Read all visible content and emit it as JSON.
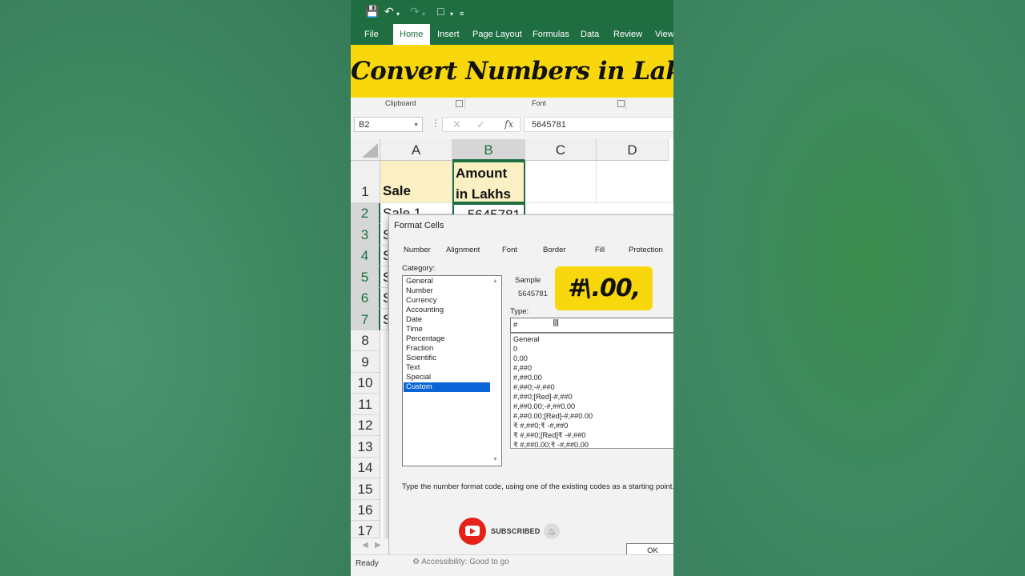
{
  "quick_access": {
    "save_icon": "save-icon",
    "undo_icon": "undo-icon",
    "redo_icon": "redo-icon",
    "present_icon": "present-icon",
    "customize_icon": "customize-icon"
  },
  "ribbon": {
    "tabs": [
      {
        "label": "File"
      },
      {
        "label": "Home"
      },
      {
        "label": "Insert"
      },
      {
        "label": "Page Layout"
      },
      {
        "label": "Formulas"
      },
      {
        "label": "Data"
      },
      {
        "label": "Review"
      },
      {
        "label": "View"
      }
    ],
    "active_tab": "Home",
    "groups": [
      {
        "label": "Clipboard"
      },
      {
        "label": "Font"
      }
    ]
  },
  "banner": {
    "text": "Convert Numbers in Lakhs",
    "color": "#f8d80d"
  },
  "formula_bar": {
    "name_box": "B2",
    "value": "5645781",
    "fx_label": "fx"
  },
  "sheet": {
    "columns": [
      "A",
      "B",
      "C",
      "D"
    ],
    "rows": [
      "1",
      "2",
      "3",
      "4",
      "5",
      "6",
      "7",
      "8",
      "9",
      "10",
      "11",
      "12",
      "13",
      "14",
      "15",
      "16",
      "17"
    ],
    "a1": "Sale",
    "b1_line1": "Amount",
    "b1_line2": "in Lakhs",
    "a2": "Sale 1",
    "b2": "5645781",
    "a_partial": [
      "S",
      "S",
      "S",
      "S",
      "S"
    ]
  },
  "dialog": {
    "title": "Format Cells",
    "tabs": [
      {
        "label": "Number"
      },
      {
        "label": "Alignment"
      },
      {
        "label": "Font"
      },
      {
        "label": "Border"
      },
      {
        "label": "Fill"
      },
      {
        "label": "Protection"
      }
    ],
    "category_label": "Category:",
    "categories": [
      "General",
      "Number",
      "Currency",
      "Accounting",
      "Date",
      "Time",
      "Percentage",
      "Fraction",
      "Scientific",
      "Text",
      "Special",
      "Custom"
    ],
    "selected_category": "Custom",
    "sample_label": "Sample",
    "sample_value": "5645781",
    "type_label": "Type:",
    "type_value": "#",
    "formats": [
      "General",
      "0",
      "0.00",
      "#,##0",
      "#,##0.00",
      "#,##0;-#,##0",
      "#,##0;[Red]-#,##0",
      "#,##0.00;-#,##0.00",
      "#,##0.00;[Red]-#,##0.00",
      "₹ #,##0;₹ -#,##0",
      "₹ #,##0;[Red]₹ -#,##0",
      "₹ #,##0.00;₹ -#,##0.00"
    ],
    "callout": "#\\.00,",
    "description": "Type the number format code, using one of the existing codes as a starting point.",
    "ok_label": "OK"
  },
  "overlay": {
    "subscribed": "SUBSCRIBED"
  },
  "status": {
    "ready": "Ready",
    "accessibility": "Accessibility: Good to go"
  },
  "colors": {
    "excel_green": "#1e6e42",
    "selection_blue": "#0a64d8",
    "header_fill": "#fbf0c3",
    "youtube_red": "#e62117"
  }
}
